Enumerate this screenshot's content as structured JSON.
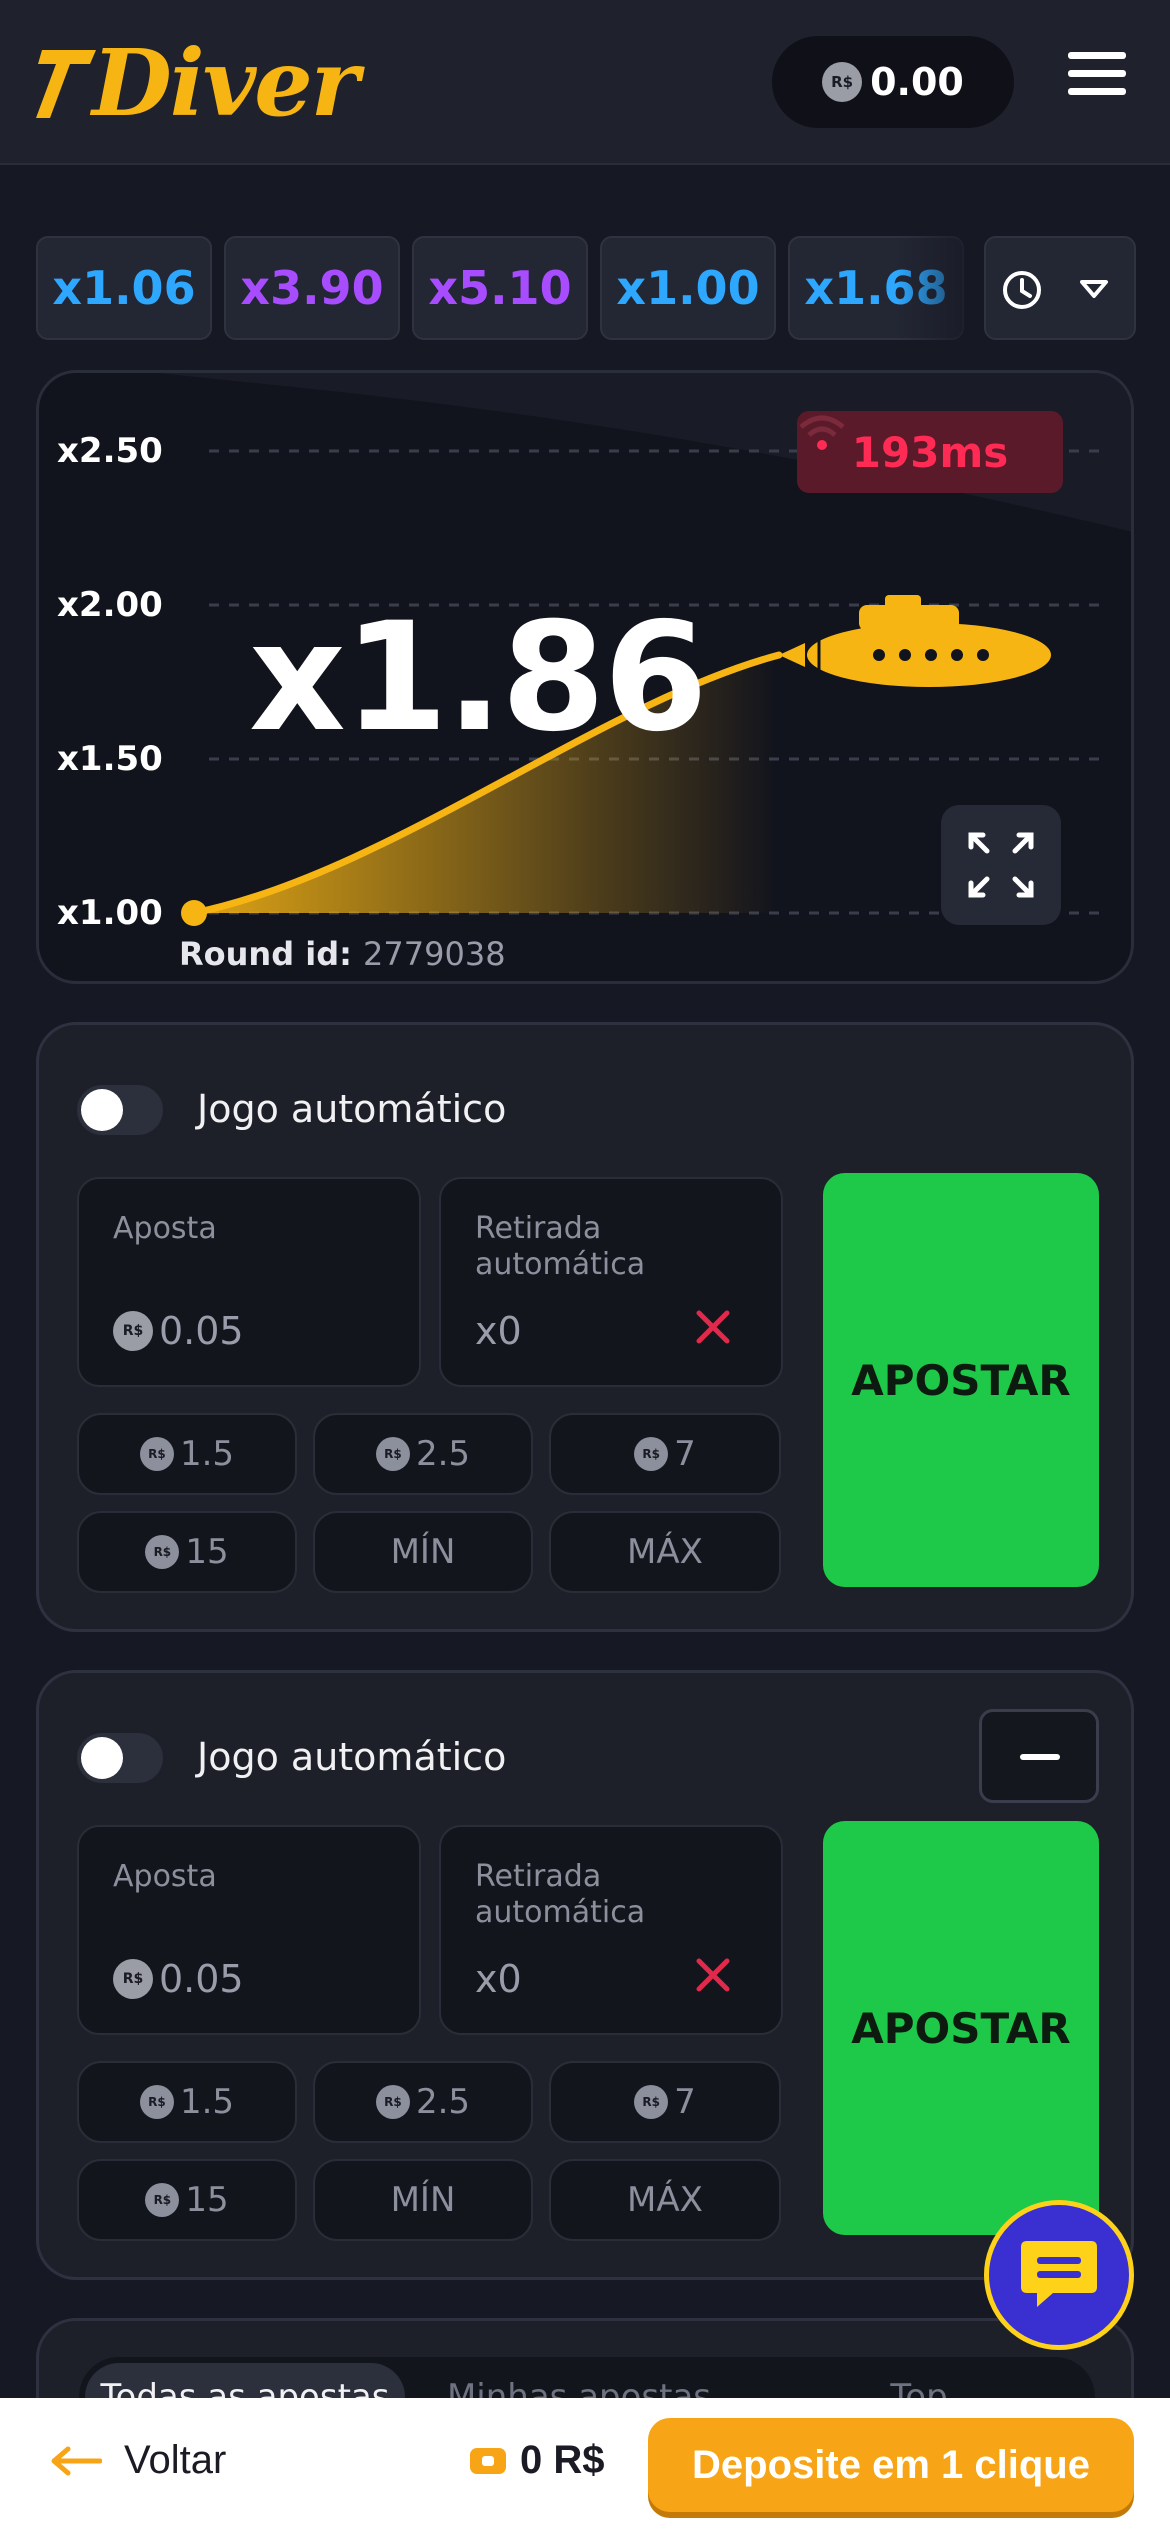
{
  "header": {
    "logo_text": "Diver",
    "balance": "0.00",
    "currency_symbol": "R$"
  },
  "history": [
    {
      "label": "x1.06",
      "color": "#2ea8ff"
    },
    {
      "label": "x3.90",
      "color": "#a84cff"
    },
    {
      "label": "x5.10",
      "color": "#a84cff"
    },
    {
      "label": "x1.00",
      "color": "#2ea8ff"
    },
    {
      "label": "x1.68",
      "color": "#2ea8ff"
    }
  ],
  "game": {
    "y_axis": [
      "x2.50",
      "x2.00",
      "x1.50",
      "x1.00"
    ],
    "ping": "193ms",
    "multiplier": "x1.86",
    "round_id_label": "Round id:",
    "round_id": "2779038"
  },
  "bet_panels": [
    {
      "auto_label": "Jogo automático",
      "bet_label": "Aposta",
      "bet_value": "0.05",
      "cashout_label": "Retirada automática",
      "cashout_value": "x0",
      "chips": [
        "1.5",
        "2.5",
        "7",
        "15"
      ],
      "min_label": "MÍN",
      "max_label": "MÁX",
      "bet_button": "APOSTAR"
    },
    {
      "auto_label": "Jogo automático",
      "bet_label": "Aposta",
      "bet_value": "0.05",
      "cashout_label": "Retirada automática",
      "cashout_value": "x0",
      "chips": [
        "1.5",
        "2.5",
        "7",
        "15"
      ],
      "min_label": "MÍN",
      "max_label": "MÁX",
      "bet_button": "APOSTAR"
    }
  ],
  "tabs": [
    "Todas as apostas",
    "Minhas apostas",
    "Top"
  ],
  "bottom": {
    "back_label": "Voltar",
    "wallet_value": "0 R$",
    "deposit_label": "Deposite em 1 clique"
  },
  "colors": {
    "accent": "#f7b514",
    "bet_green": "#1ec949",
    "ping_red": "#ff2b55",
    "deposit_orange": "#f7a416"
  }
}
